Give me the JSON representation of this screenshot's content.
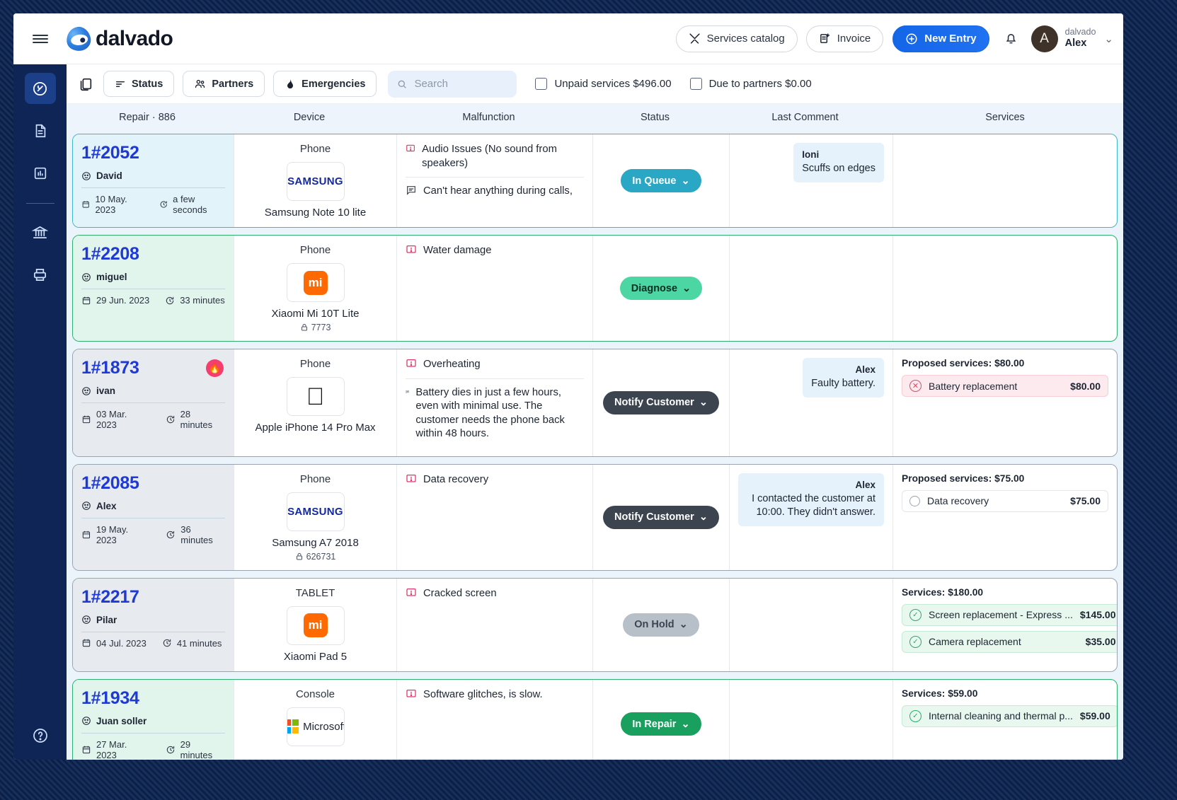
{
  "header": {
    "logo_text": "dalvado",
    "services_catalog": "Services catalog",
    "invoice": "Invoice",
    "new_entry": "New Entry",
    "user_org": "dalvado",
    "user_name": "Alex",
    "avatar_initial": "A"
  },
  "sidebar": {
    "items": [
      {
        "name": "repairs",
        "icon": "wrench-circle-icon",
        "active": true
      },
      {
        "name": "documents",
        "icon": "document-icon",
        "active": false
      },
      {
        "name": "reports",
        "icon": "bar-chart-icon",
        "active": false
      },
      {
        "name": "finance",
        "icon": "bank-icon",
        "active": false
      },
      {
        "name": "print",
        "icon": "printer-icon",
        "active": false
      }
    ],
    "help": "?"
  },
  "toolbar": {
    "status": "Status",
    "partners": "Partners",
    "emergencies": "Emergencies",
    "search_placeholder": "Search",
    "unpaid_services": "Unpaid services $496.00",
    "due_to_partners": "Due to partners $0.00"
  },
  "table": {
    "columns": [
      "Repair  ·  886",
      "Device",
      "Malfunction",
      "Status",
      "Last Comment",
      "Services"
    ],
    "rows": [
      {
        "id": "1#2052",
        "customer": "David",
        "date": "10 May. 2023",
        "elapsed": "a few seconds",
        "urgent": false,
        "highlight": "cyan",
        "device_type": "Phone",
        "device_brand": "samsung",
        "device_name": "Samsung Note 10 lite",
        "imei": "",
        "malfunctions": [
          "Audio Issues (No sound from speakers)"
        ],
        "notes": [
          "Can't hear anything during calls,"
        ],
        "status": "In Queue",
        "status_style": "queue",
        "comment_author": "Ioni",
        "comment_text": "Scuffs on edges",
        "comment_align": "left",
        "services_title": "",
        "services": []
      },
      {
        "id": "1#2208",
        "customer": "miguel",
        "date": "29 Jun. 2023",
        "elapsed": "33 minutes",
        "urgent": false,
        "highlight": "green",
        "device_type": "Phone",
        "device_brand": "mi",
        "device_name": "Xiaomi Mi 10T Lite",
        "imei": "7773",
        "malfunctions": [
          "Water damage"
        ],
        "notes": [],
        "status": "Diagnose",
        "status_style": "diagnose",
        "comment_author": "",
        "comment_text": "",
        "comment_align": "right",
        "services_title": "",
        "services": []
      },
      {
        "id": "1#1873",
        "customer": "ivan",
        "date": "03 Mar. 2023",
        "elapsed": "28 minutes",
        "urgent": true,
        "highlight": "plain",
        "device_type": "Phone",
        "device_brand": "apple",
        "device_name": "Apple iPhone 14 Pro Max",
        "imei": "",
        "malfunctions": [
          "Overheating"
        ],
        "notes": [
          "Battery dies in just a few hours, even with minimal use. The customer needs the phone back within 48 hours."
        ],
        "status": "Notify Customer",
        "status_style": "notify",
        "comment_author": "Alex",
        "comment_text": "Faulty battery.",
        "comment_align": "right",
        "services_title": "Proposed services: $80.00",
        "services": [
          {
            "icon": "x-circle-icon",
            "name": "Battery replacement",
            "price": "$80.00",
            "style": "pink"
          }
        ]
      },
      {
        "id": "1#2085",
        "customer": "Alex",
        "date": "19 May. 2023",
        "elapsed": "36 minutes",
        "urgent": false,
        "highlight": "plain",
        "device_type": "Phone",
        "device_brand": "samsung",
        "device_name": "Samsung A7 2018",
        "imei": "626731",
        "malfunctions": [
          "Data recovery"
        ],
        "notes": [],
        "status": "Notify Customer",
        "status_style": "notify",
        "comment_author": "Alex",
        "comment_text": "I contacted the customer at 10:00. They didn't answer.",
        "comment_align": "right",
        "services_title": "Proposed services: $75.00",
        "services": [
          {
            "icon": "circle-icon",
            "name": "Data recovery",
            "price": "$75.00",
            "style": "white"
          }
        ]
      },
      {
        "id": "1#2217",
        "customer": "Pilar",
        "date": "04 Jul. 2023",
        "elapsed": "41 minutes",
        "urgent": false,
        "highlight": "plain",
        "device_type": "TABLET",
        "device_brand": "mi",
        "device_name": "Xiaomi Pad 5",
        "imei": "",
        "malfunctions": [
          "Cracked screen"
        ],
        "notes": [],
        "status": "On Hold",
        "status_style": "hold",
        "comment_author": "",
        "comment_text": "",
        "comment_align": "right",
        "services_title": "Services: $180.00",
        "services": [
          {
            "icon": "check-circle-icon",
            "name": "Screen replacement - Express ...",
            "price": "$145.00",
            "style": "green"
          },
          {
            "icon": "check-circle-icon",
            "name": "Camera replacement",
            "price": "$35.00",
            "style": "green"
          }
        ]
      },
      {
        "id": "1#1934",
        "customer": "Juan soller",
        "date": "27 Mar. 2023",
        "elapsed": "29 minutes",
        "urgent": false,
        "highlight": "green",
        "device_type": "Console",
        "device_brand": "microsoft",
        "device_name": "Microsoft",
        "imei": "",
        "malfunctions": [
          "Software glitches, is slow."
        ],
        "notes": [],
        "status": "In Repair",
        "status_style": "repair",
        "comment_author": "",
        "comment_text": "",
        "comment_align": "right",
        "services_title": "Services: $59.00",
        "services": [
          {
            "icon": "check-circle-icon",
            "name": "Internal cleaning and thermal p...",
            "price": "$59.00",
            "style": "green"
          }
        ]
      }
    ]
  },
  "colors": {
    "brand_blue": "#1565e8",
    "sidebar": "#0f2555",
    "id_blue": "#1f39d6",
    "cyan": "#2aa7c4",
    "green": "#2fae6e"
  }
}
